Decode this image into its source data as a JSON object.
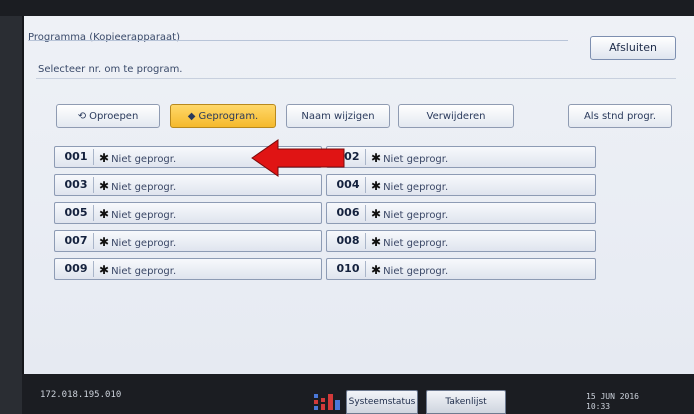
{
  "window": {
    "title": "Programma (Kopieerapparaat)",
    "close_label": "Afsluiten"
  },
  "instruction": "Selecteer nr. om te program.",
  "toolbar": [
    {
      "label": "Oproepen",
      "icon": "recall-icon",
      "active": false
    },
    {
      "label": "Geprogram.",
      "icon": "program-icon",
      "active": true
    },
    {
      "label": "Naam wijzigen",
      "icon": "",
      "active": false
    },
    {
      "label": "Verwijderen",
      "icon": "",
      "active": false
    },
    {
      "label": "Als stnd progr.",
      "icon": "",
      "active": false
    }
  ],
  "programs": [
    {
      "number": "001",
      "label": "Niet geprogr."
    },
    {
      "number": "002",
      "label": "Niet geprogr."
    },
    {
      "number": "003",
      "label": "Niet geprogr."
    },
    {
      "number": "004",
      "label": "Niet geprogr."
    },
    {
      "number": "005",
      "label": "Niet geprogr."
    },
    {
      "number": "006",
      "label": "Niet geprogr."
    },
    {
      "number": "007",
      "label": "Niet geprogr."
    },
    {
      "number": "008",
      "label": "Niet geprogr."
    },
    {
      "number": "009",
      "label": "Niet geprogr."
    },
    {
      "number": "010",
      "label": "Niet geprogr."
    }
  ],
  "footer": {
    "ip": "172.018.195.010",
    "system_status": "Systeemstatus",
    "job_list": "Takenlijst",
    "date": "15 JUN  2016",
    "time": "10:33"
  },
  "colors": {
    "active_button": "#f5b92c",
    "pointer_arrow": "#e01414"
  }
}
